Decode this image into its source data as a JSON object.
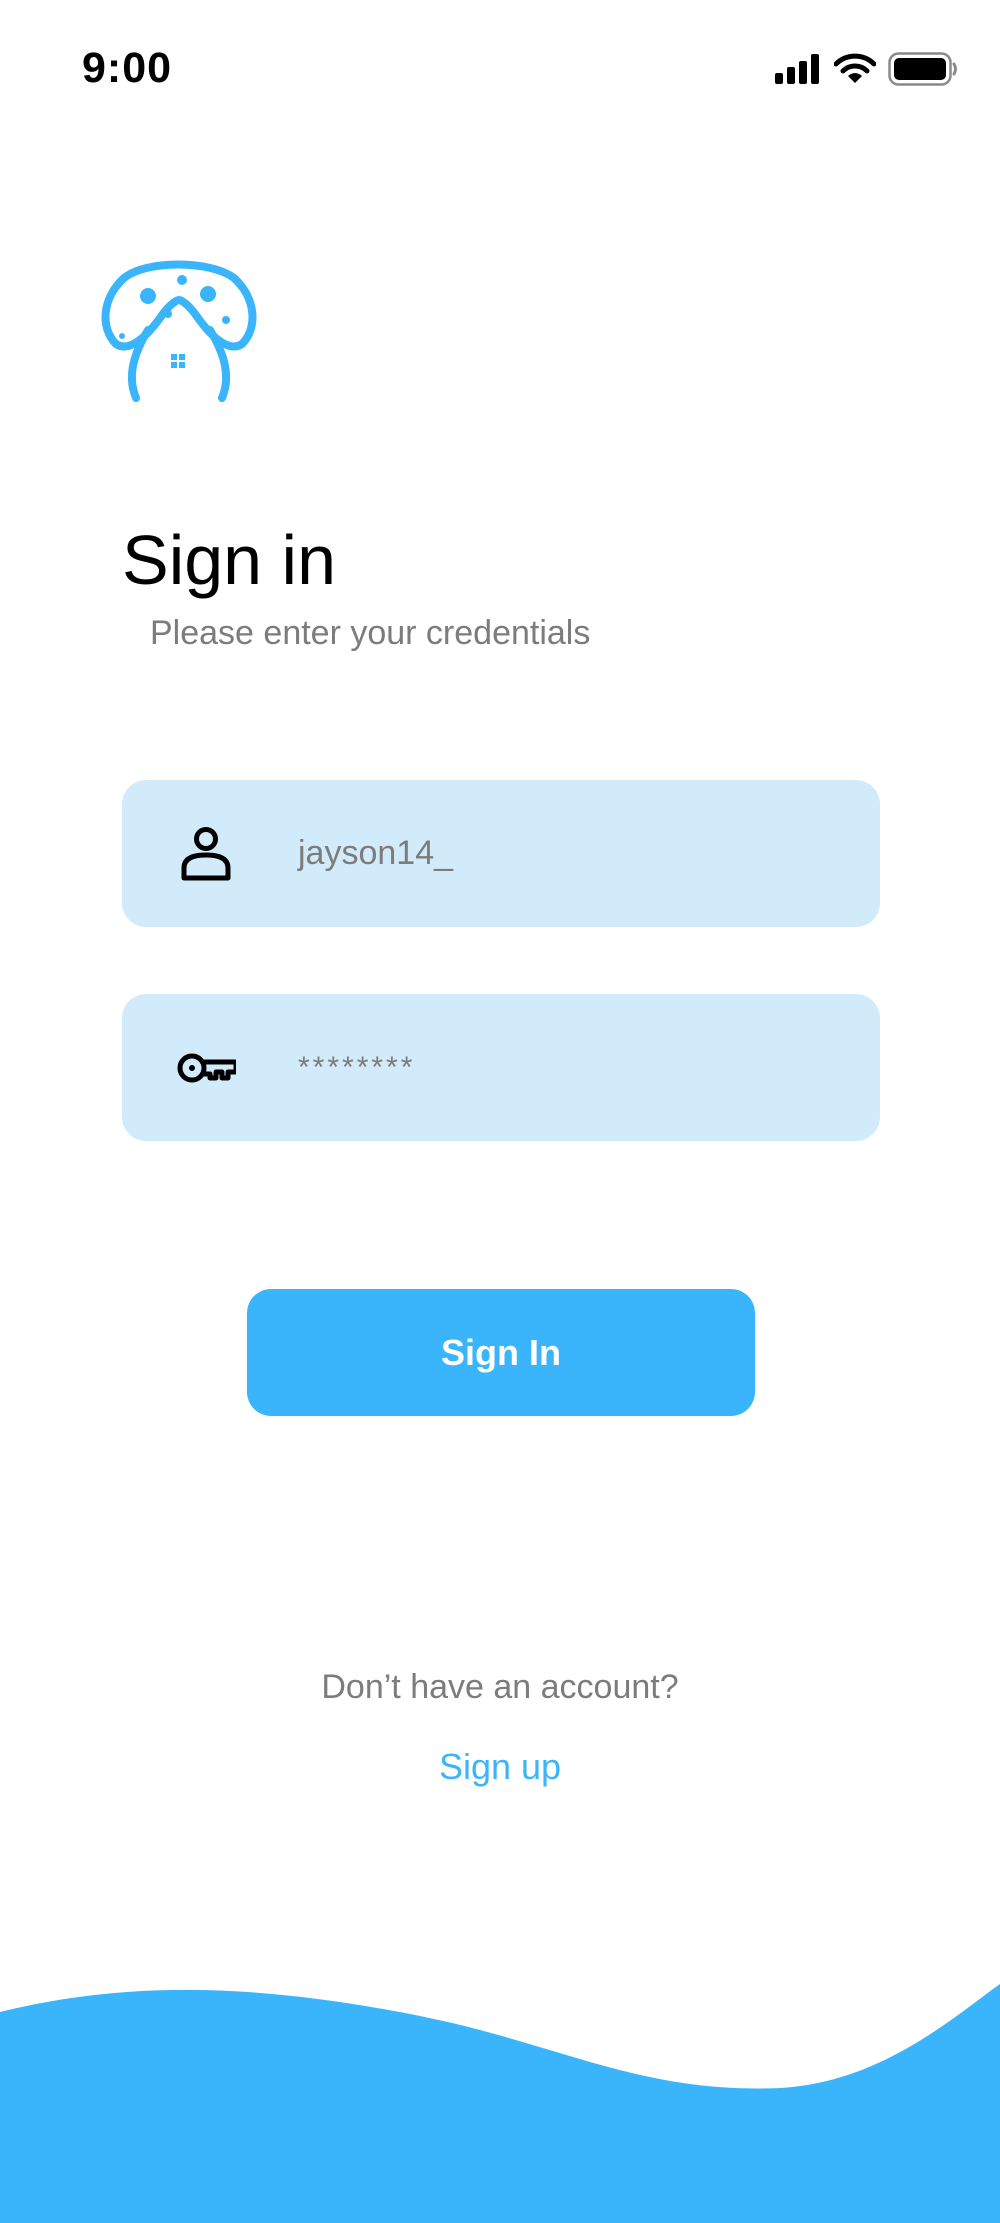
{
  "status_bar": {
    "time": "9:00",
    "icons": [
      "signal-icon",
      "wifi-icon",
      "battery-icon"
    ]
  },
  "logo": {
    "icon": "mushroom-house-logo",
    "color": "#3AB5FB"
  },
  "header": {
    "title": "Sign in",
    "subtitle": "Please enter your credentials"
  },
  "form": {
    "username": {
      "icon": "user-icon",
      "value": "jayson14_"
    },
    "password": {
      "icon": "key-icon",
      "value": "********"
    },
    "submit_label": "Sign In"
  },
  "footer": {
    "prompt": "Don’t have an account?",
    "signup_label": "Sign up"
  },
  "colors": {
    "accent": "#3AB5FB",
    "field_background": "#D1EBFB",
    "muted_text": "#7C7C7C"
  }
}
